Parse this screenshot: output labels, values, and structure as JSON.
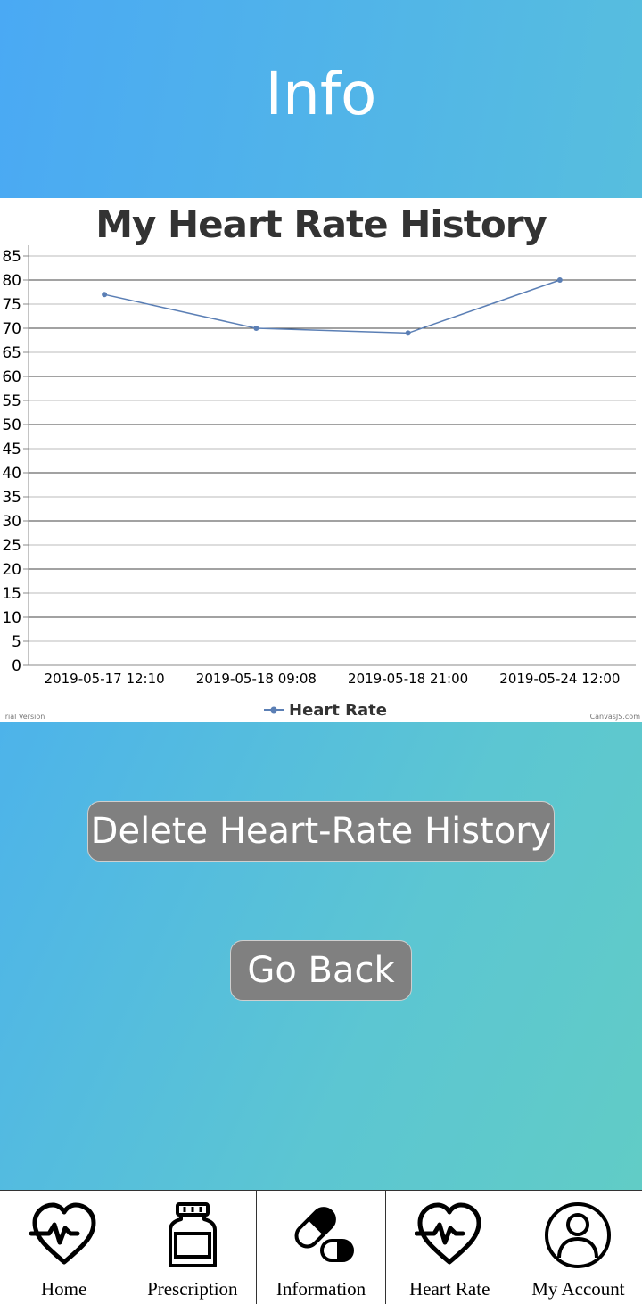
{
  "header": {
    "title": "Info"
  },
  "chart_data": {
    "type": "line",
    "title": "My Heart Rate History",
    "categories": [
      "2019-05-17 12:10",
      "2019-05-18 09:08",
      "2019-05-18 21:00",
      "2019-05-24 12:00"
    ],
    "series": [
      {
        "name": "Heart Rate",
        "values": [
          77,
          70,
          69,
          80
        ],
        "color": "#5b7fb5"
      }
    ],
    "ylim": [
      0,
      85
    ],
    "yticks": [
      0,
      5,
      10,
      15,
      20,
      25,
      30,
      35,
      40,
      45,
      50,
      55,
      60,
      65,
      70,
      75,
      80,
      85
    ],
    "grid": true,
    "legend_position": "bottom-center",
    "watermark_left": "Trial Version",
    "watermark_right": "CanvasJS.com"
  },
  "actions": {
    "delete_label": "Delete Heart-Rate History",
    "back_label": "Go Back"
  },
  "tabbar": {
    "items": [
      {
        "label": "Home",
        "icon": "heartbeat-icon"
      },
      {
        "label": "Prescription",
        "icon": "pill-bottle-icon"
      },
      {
        "label": "Information",
        "icon": "capsule-icon"
      },
      {
        "label": "Heart Rate",
        "icon": "heartbeat-icon"
      },
      {
        "label": "My Account",
        "icon": "user-circle-icon"
      }
    ]
  }
}
